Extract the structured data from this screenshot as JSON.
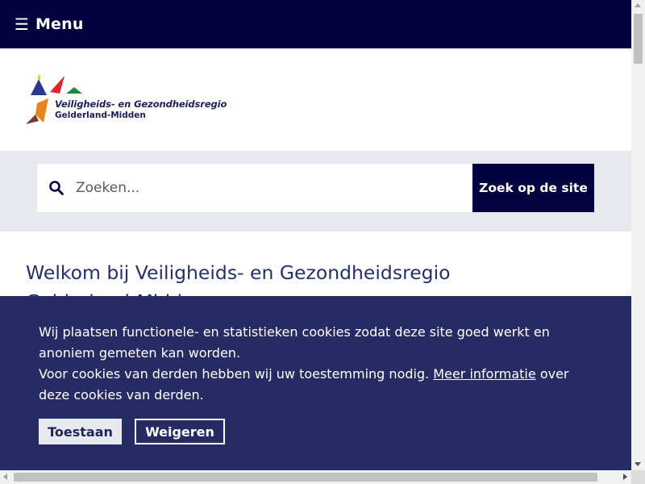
{
  "header": {
    "menu_icon": "menu-icon",
    "menu_label": "Menu",
    "background": "#02023f"
  },
  "logo": {
    "line1": "Veiligheids- en Gezondheidsregio",
    "line2": "Gelderland-Midden"
  },
  "search": {
    "placeholder": "Zoeken...",
    "value": "",
    "icon": "search-icon",
    "button_label": "Zoek op de site"
  },
  "main": {
    "welcome_title": "Welkom bij Veiligheids- en Gezondheidsregio Gelderland-Midden"
  },
  "cookie_banner": {
    "line1": "Wij plaatsen functionele- en statistieken cookies zodat deze site goed werkt en anoniem gemeten kan worden.",
    "line2_prefix": "Voor cookies van derden hebben wij uw toestemming nodig.",
    "link_label": "Meer informatie",
    "line2_suffix": "over deze cookies van derden.",
    "allow_label": "Toestaan",
    "deny_label": "Weigeren",
    "background": "#272b63"
  }
}
